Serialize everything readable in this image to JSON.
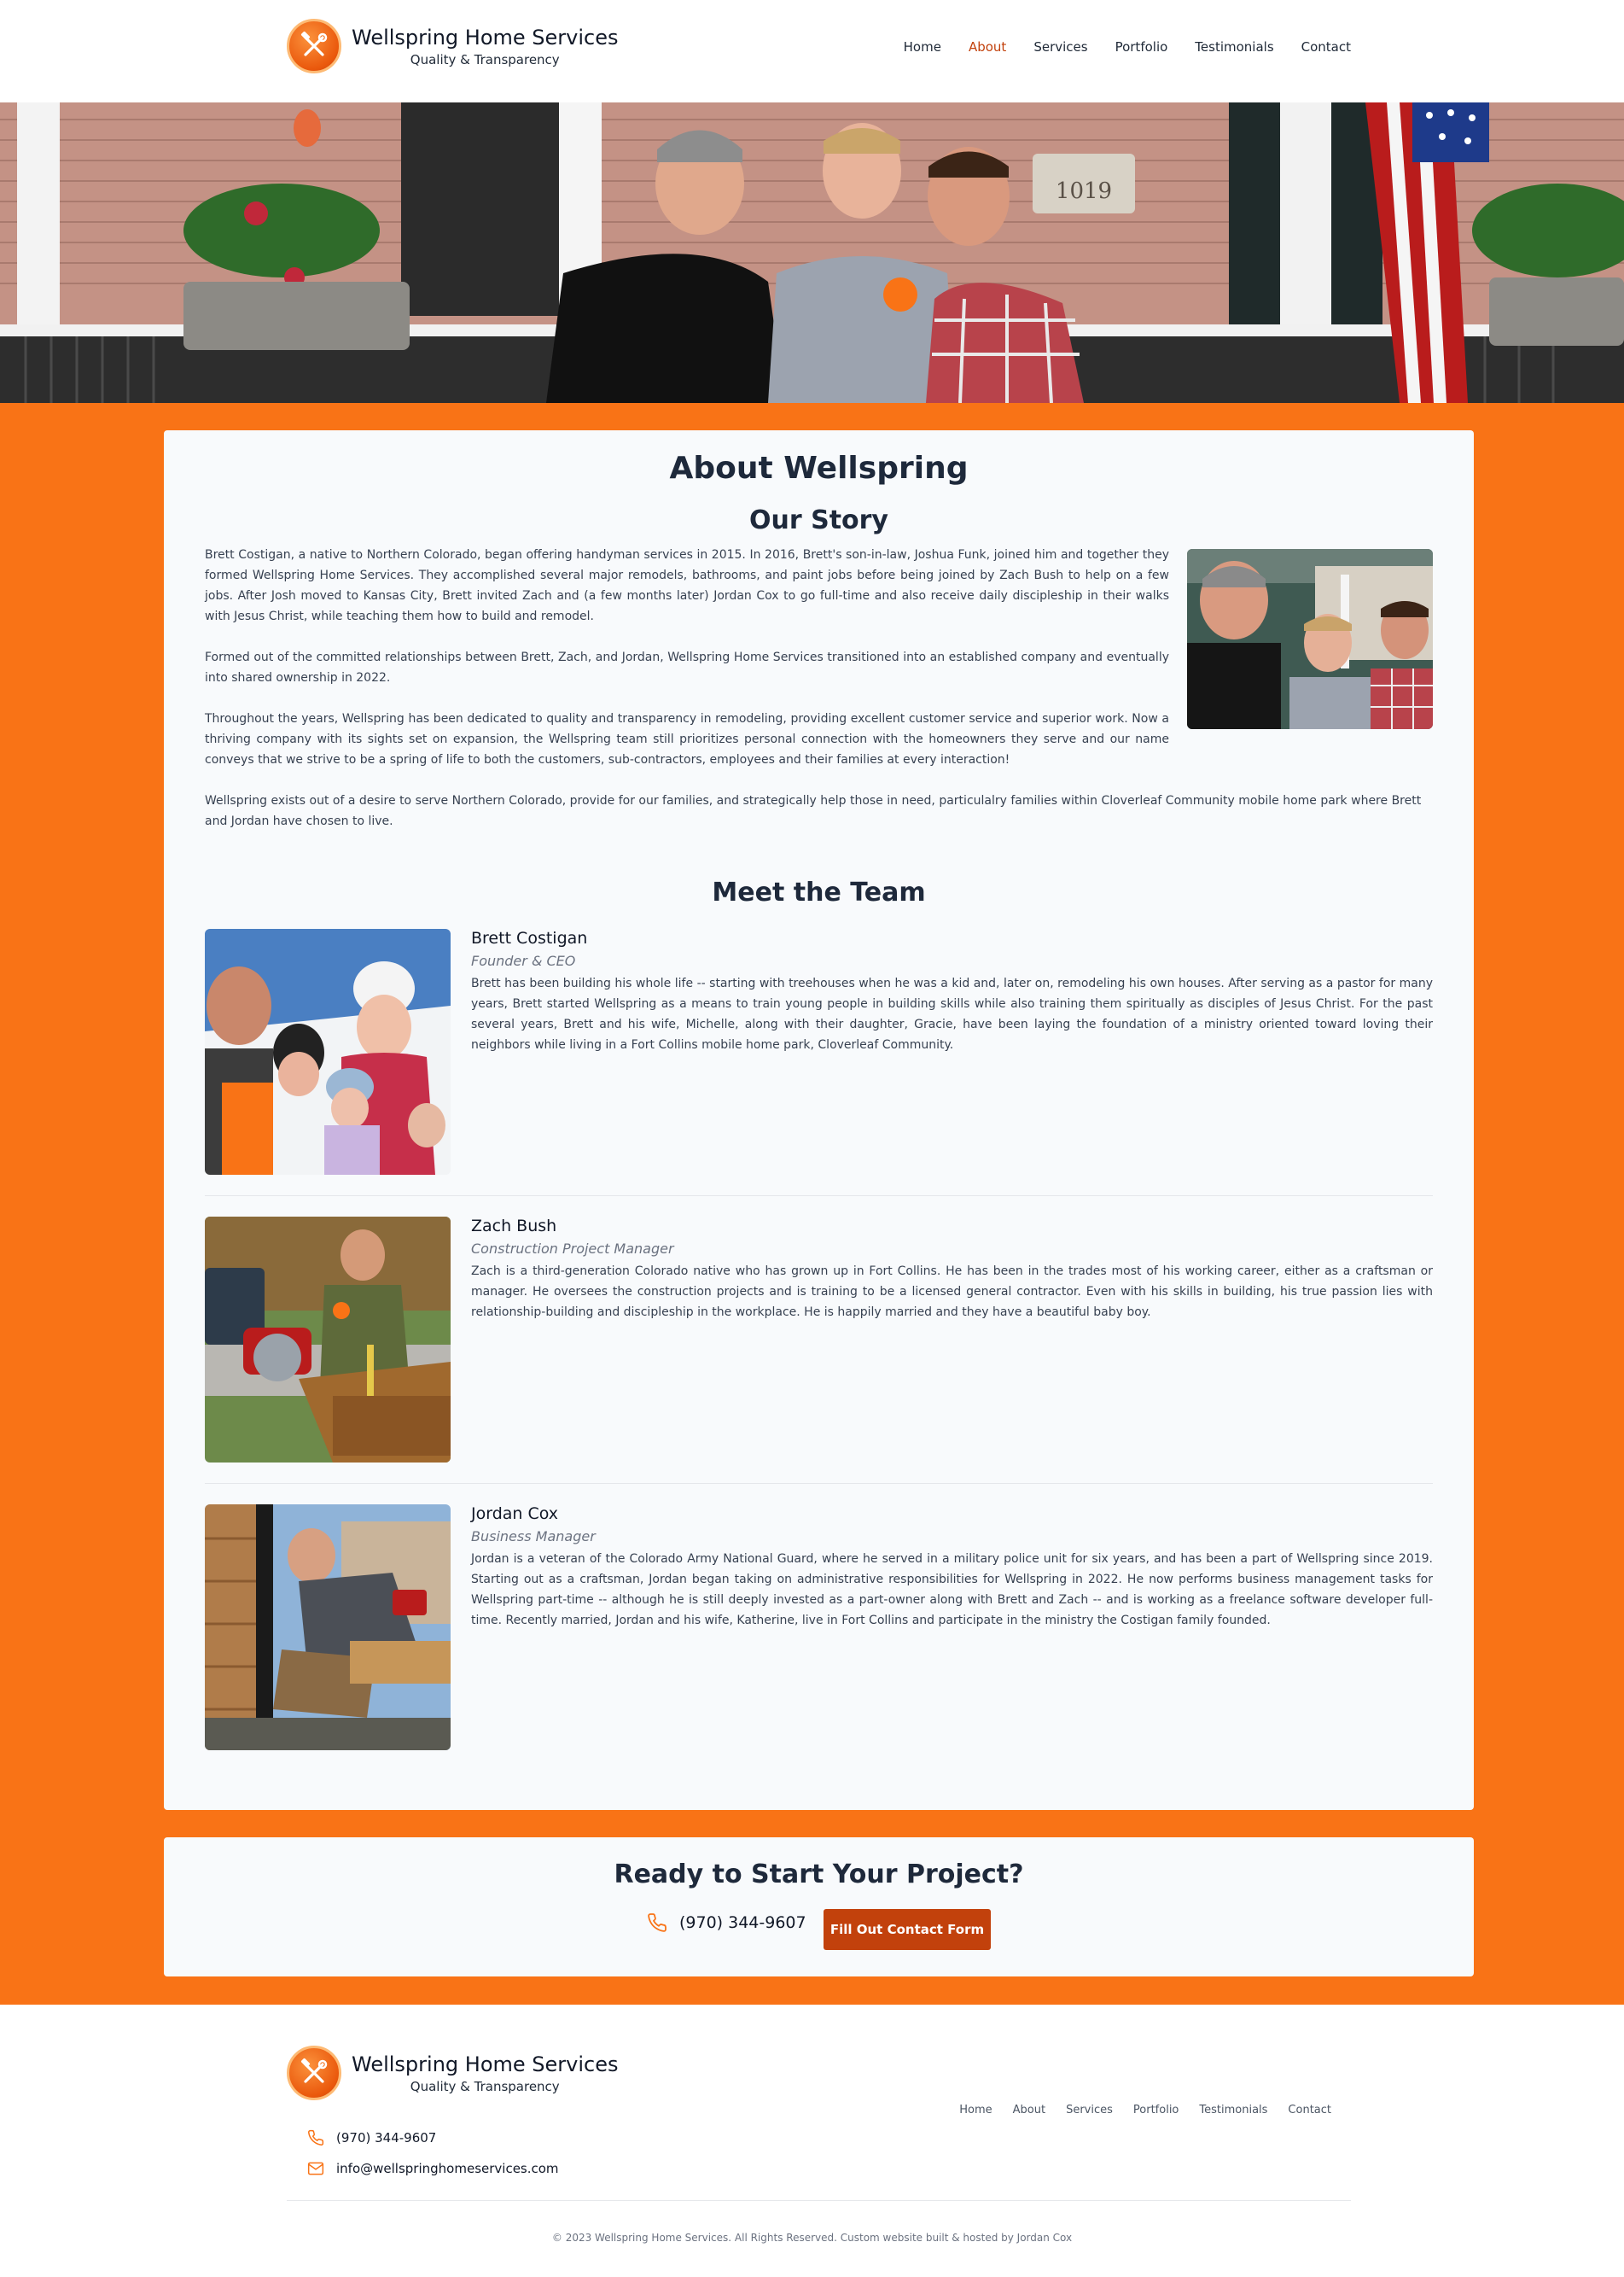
{
  "brand": {
    "name": "Wellspring Home Services",
    "tagline": "Quality & Transparency"
  },
  "nav": {
    "items": [
      {
        "label": "Home"
      },
      {
        "label": "About"
      },
      {
        "label": "Services"
      },
      {
        "label": "Portfolio"
      },
      {
        "label": "Testimonials"
      },
      {
        "label": "Contact"
      }
    ],
    "active": "About"
  },
  "about": {
    "title": "About Wellspring",
    "story_heading": "Our Story",
    "story_paragraphs": [
      "Brett Costigan, a native to Northern Colorado, began offering handyman services in 2015. In 2016, Brett's son-in-law, Joshua Funk, joined him and together they formed Wellspring Home Services. They accomplished several major remodels, bathrooms, and paint jobs before being joined by Zach Bush to help on a few jobs. After Josh moved to Kansas City, Brett invited Zach and (a few months later) Jordan Cox to go full-time and also receive daily discipleship in their walks with Jesus Christ, while teaching them how to build and remodel.",
      "Formed out of the committed relationships between Brett, Zach, and Jordan, Wellspring Home Services transitioned into an established company and eventually into shared ownership in 2022.",
      "Throughout the years, Wellspring has been dedicated to quality and transparency in remodeling, providing excellent customer service and superior work. Now a thriving company with its sights set on expansion, the Wellspring team still prioritizes personal connection with the homeowners they serve and our name conveys that we strive to be a spring of life to both the customers, sub-contractors, employees and their families at every interaction!",
      "Wellspring exists out of a desire to serve Northern Colorado, provide for our families, and strategically help those in need, particulalry families within Cloverleaf Community mobile home park where Brett and Jordan have chosen to live."
    ],
    "team_heading": "Meet the Team",
    "team": [
      {
        "name": "Brett Costigan",
        "role": "Founder & CEO",
        "bio": "Brett has been building his whole life -- starting with treehouses when he was a kid and, later on, remodeling his own houses. After serving as a pastor for many years, Brett started Wellspring as a means to train young people in building skills while also training them spiritually as disciples of Jesus Christ. For the past several years, Brett and his wife, Michelle, along with their daughter, Gracie, have been laying the foundation of a ministry oriented toward loving their neighbors while living in a Fort Collins mobile home park, Cloverleaf Community."
      },
      {
        "name": "Zach Bush",
        "role": "Construction Project Manager",
        "bio": "Zach is a third-generation Colorado native who has grown up in Fort Collins. He has been in the trades most of his working career, either as a craftsman or manager. He oversees the construction projects and is training to be a licensed general contractor. Even with his skills in building, his true passion lies with relationship-building and discipleship in the workplace. He is happily married and they have a beautiful baby boy."
      },
      {
        "name": "Jordan Cox",
        "role": "Business Manager",
        "bio": "Jordan is a veteran of the Colorado Army National Guard, where he served in a military police unit for six years, and has been a part of Wellspring since 2019. Starting out as a craftsman, Jordan began taking on administrative responsibilities for Wellspring in 2022. He now performs business management tasks for Wellspring part-time -- although he is still deeply invested as a part-owner along with Brett and Zach -- and is working as a freelance software developer full-time. Recently married, Jordan and his wife, Katherine, live in Fort Collins and participate in the ministry the Costigan family founded."
      }
    ]
  },
  "cta": {
    "title": "Ready to Start Your Project?",
    "phone": "(970) 344-9607",
    "button_label": "Fill Out Contact Form"
  },
  "footer": {
    "phone": "(970) 344-9607",
    "email": "info@wellspringhomeservices.com",
    "copyright": "© 2023 Wellspring Home Services. All Rights Reserved. Custom website built & hosted by Jordan Cox"
  },
  "hero": {
    "house_number": "1019"
  },
  "colors": {
    "accent": "#f97316",
    "accent_dark": "#c2410c",
    "card": "#f8fafc"
  }
}
